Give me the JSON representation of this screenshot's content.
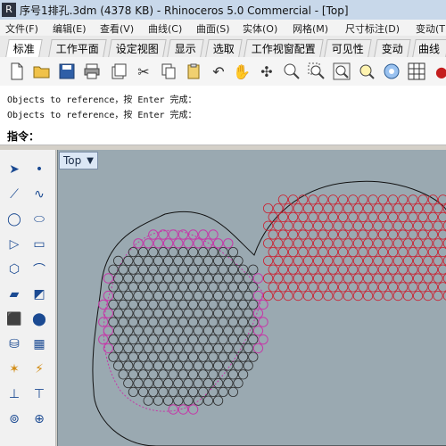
{
  "window": {
    "title": "序号1排孔.3dm (4378 KB) - Rhinoceros 5.0 Commercial - [Top]"
  },
  "menu": [
    "文件(F)",
    "编辑(E)",
    "查看(V)",
    "曲线(C)",
    "曲面(S)",
    "实体(O)",
    "网格(M)",
    "尺寸标注(D)",
    "变动(T"
  ],
  "tabs": [
    "标准",
    "工作平面",
    "设定视图",
    "显示",
    "选取",
    "工作视窗配置",
    "可见性",
    "变动",
    "曲线工"
  ],
  "history": [
    "Objects to reference，按 Enter 完成：",
    "Objects to reference，按 Enter 完成："
  ],
  "command": {
    "label": "指令：",
    "value": ""
  },
  "viewport": {
    "name": "Top",
    "dropdown_icon": "▼"
  },
  "toolbar_icons": [
    "new-icon",
    "open-icon",
    "save-icon",
    "print-icon",
    "import-icon",
    "cut-icon",
    "copy-icon",
    "paste-icon",
    "undo-icon",
    "pan-icon",
    "rotate-icon",
    "zoom-window-icon",
    "zoom-dynamic-icon",
    "zoom-extents-icon",
    "zoom-selected-icon",
    "properties-icon",
    "grid-icon",
    "lights-icon"
  ],
  "left_tools": [
    "select-icon",
    "point-icon",
    "polyline-icon",
    "curve-icon",
    "circle-icon",
    "ellipse-icon",
    "polygon-icon",
    "rectangle-icon",
    "fillet-icon",
    "arc-icon",
    "surface-icon",
    "extrude-icon",
    "box-icon",
    "sphere-icon",
    "cylinder-icon",
    "mesh-icon",
    "transform-icon",
    "gumball-icon",
    "dim-icon",
    "trim-icon",
    "split-icon",
    "boolean-icon"
  ],
  "colors": {
    "accent": "#3a78c2",
    "viewport_bg": "#9aa9b1",
    "hole_outline": "#cc1f2f",
    "selection_magenta": "#c43aa8"
  }
}
